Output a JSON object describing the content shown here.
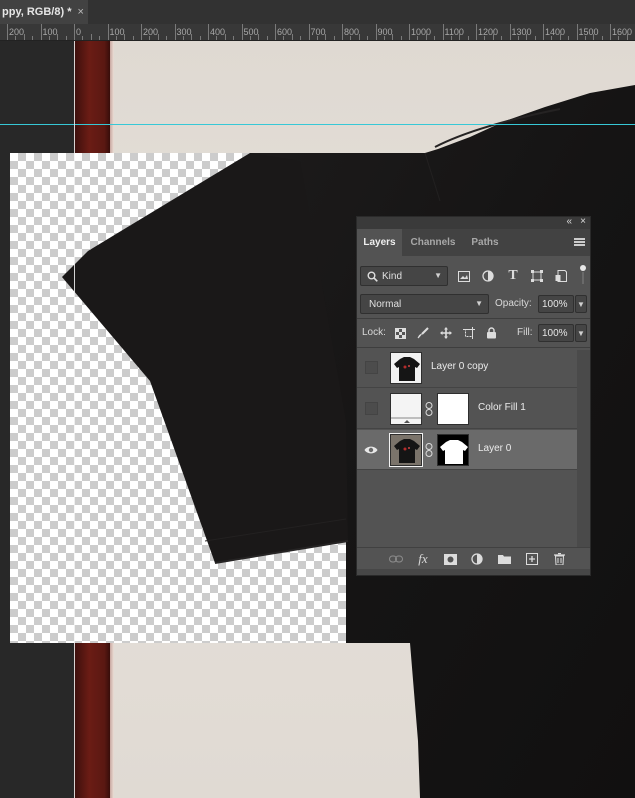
{
  "document": {
    "tab_title": "ppy, RGB/8) *",
    "tab_close": "×"
  },
  "ruler": {
    "labels": [
      "200",
      "100",
      "0",
      "100",
      "200",
      "300",
      "400",
      "500",
      "600",
      "700",
      "800",
      "900",
      "1000",
      "1100",
      "1200",
      "1300",
      "1400",
      "1500",
      "1600"
    ]
  },
  "layers_panel": {
    "collapse_glyph": "«",
    "close_glyph": "×",
    "tabs": [
      {
        "label": "Layers",
        "active": true
      },
      {
        "label": "Channels",
        "active": false
      },
      {
        "label": "Paths",
        "active": false
      }
    ],
    "filter": {
      "kind_label": "Kind",
      "icons": [
        "image-filter-icon",
        "adjustment-filter-icon",
        "type-filter-icon",
        "shape-filter-icon",
        "smart-object-filter-icon"
      ]
    },
    "blend_mode": "Normal",
    "opacity_label": "Opacity:",
    "opacity_value": "100%",
    "lock_label": "Lock:",
    "lock_icons": [
      "lock-transparent-pixels-icon",
      "lock-image-pixels-icon",
      "lock-position-icon",
      "prevent-autonest-icon",
      "lock-all-icon"
    ],
    "fill_label": "Fill:",
    "fill_value": "100%",
    "layers": [
      {
        "name": "Layer 0 copy",
        "visible": false,
        "selected": false,
        "has_mask": false
      },
      {
        "name": "Color Fill 1",
        "visible": false,
        "selected": false,
        "has_mask": true
      },
      {
        "name": "Layer 0",
        "visible": true,
        "selected": true,
        "has_mask": true
      }
    ],
    "footer_icons": [
      "link-layers-icon",
      "fx-icon",
      "add-mask-icon",
      "new-adjustment-layer-icon",
      "new-group-icon",
      "new-layer-icon",
      "delete-layer-icon"
    ],
    "footer_glyphs": {
      "fx": "fx"
    }
  },
  "colors": {
    "guide": "#37c8d6",
    "panel_bg": "#535353",
    "selected_layer": "#6a6a6a"
  }
}
